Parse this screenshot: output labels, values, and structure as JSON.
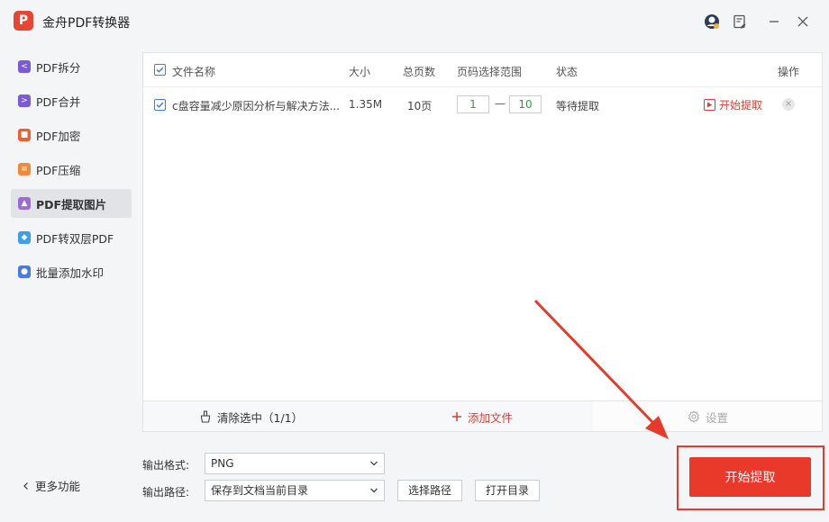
{
  "app": {
    "title": "金舟PDF转换器",
    "logo_text": "P"
  },
  "titlebar": {
    "icons": [
      "avatar-icon",
      "feedback-icon",
      "minimize-icon",
      "close-icon"
    ]
  },
  "sidebar": {
    "items": [
      {
        "label": "PDF拆分",
        "icon": "split-icon",
        "color": "#7a5ad6"
      },
      {
        "label": "PDF合并",
        "icon": "merge-icon",
        "color": "#7a5ad6"
      },
      {
        "label": "PDF加密",
        "icon": "lock-icon",
        "color": "#e8622e"
      },
      {
        "label": "PDF压缩",
        "icon": "compress-icon",
        "color": "#ef8a3a"
      },
      {
        "label": "PDF提取图片",
        "icon": "image-icon",
        "color": "#9b6bd8"
      },
      {
        "label": "PDF转双层PDF",
        "icon": "layers-icon",
        "color": "#3aa0e8"
      },
      {
        "label": "批量添加水印",
        "icon": "watermark-icon",
        "color": "#4a7be0"
      }
    ],
    "active_index": 4,
    "more_label": "更多功能"
  },
  "table": {
    "headers": {
      "name": "文件名称",
      "size": "大小",
      "pages": "总页数",
      "range": "页码选择范围",
      "status": "状态",
      "action": "操作"
    },
    "rows": [
      {
        "name": "c盘容量减少原因分析与解决方法...",
        "size": "1.35M",
        "pages": "10页",
        "range_from": "1",
        "range_to": "10",
        "status": "等待提取",
        "action": "开始提取"
      }
    ]
  },
  "panel_bar": {
    "clear": "清除选中（1/1）",
    "add": "添加文件",
    "settings": "设置"
  },
  "options": {
    "format_label": "输出格式:",
    "format_value": "PNG",
    "path_label": "输出路径:",
    "path_value": "保存到文档当前目录",
    "choose_path": "选择路径",
    "open_dir": "打开目录"
  },
  "start_button": "开始提取",
  "colors": {
    "accent": "#e8392b",
    "check": "#3b7be8",
    "page_input": "#2f9b3a"
  }
}
